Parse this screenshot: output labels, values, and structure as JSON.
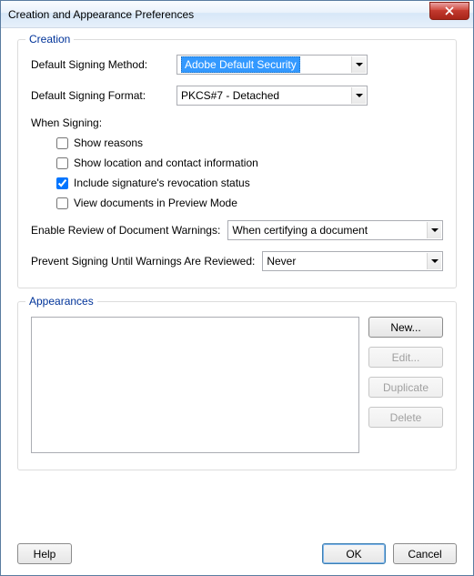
{
  "window": {
    "title": "Creation and Appearance Preferences"
  },
  "creation": {
    "group_title": "Creation",
    "signing_method_label": "Default Signing Method:",
    "signing_method_value": "Adobe Default Security",
    "signing_format_label": "Default Signing Format:",
    "signing_format_value": "PKCS#7 - Detached",
    "when_signing_label": "When Signing:",
    "checks": {
      "show_reasons": {
        "label": "Show reasons",
        "checked": false
      },
      "show_location": {
        "label": "Show location and contact information",
        "checked": false
      },
      "include_revocation": {
        "label": "Include signature's revocation status",
        "checked": true
      },
      "preview_mode": {
        "label": "View documents in Preview Mode",
        "checked": false
      }
    },
    "review_warnings_label": "Enable Review of Document Warnings:",
    "review_warnings_value": "When certifying a document",
    "prevent_signing_label": "Prevent Signing Until Warnings Are Reviewed:",
    "prevent_signing_value": "Never"
  },
  "appearances": {
    "group_title": "Appearances",
    "buttons": {
      "new": "New...",
      "edit": "Edit...",
      "duplicate": "Duplicate",
      "delete": "Delete"
    }
  },
  "footer": {
    "help": "Help",
    "ok": "OK",
    "cancel": "Cancel"
  }
}
